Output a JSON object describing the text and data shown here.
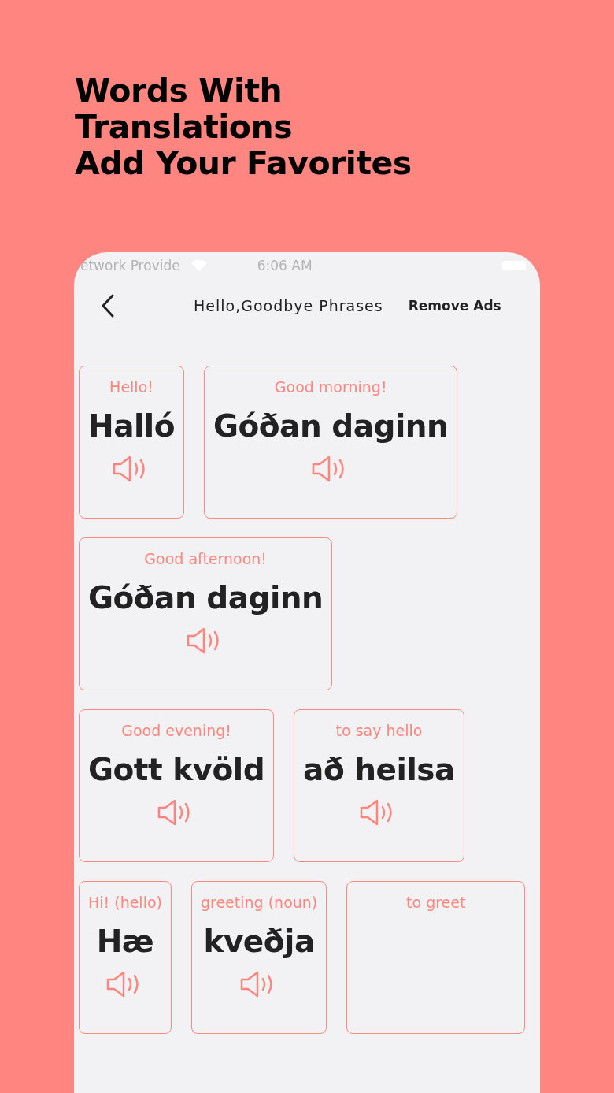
{
  "headline": [
    "Words With",
    "Translations",
    "Add Your Favorites"
  ],
  "status_bar": {
    "carrier": "etwork Provide",
    "time": "6:06 AM"
  },
  "header": {
    "title": "Hello,Goodbye Phrases",
    "action": "Remove Ads"
  },
  "cards": [
    {
      "translation": "Hello!",
      "word": "Halló"
    },
    {
      "translation": "Good morning!",
      "word": "Góðan daginn"
    },
    {
      "translation": "Good afternoon!",
      "word": "Góðan daginn"
    },
    {
      "translation": "Good evening!",
      "word": "Gott kvöld"
    },
    {
      "translation": "to say hello",
      "word": "að heilsa"
    },
    {
      "translation": "Hi! (hello)",
      "word": "Hæ"
    },
    {
      "translation": "greeting (noun)",
      "word": "kveðja"
    },
    {
      "translation": "to greet"
    }
  ]
}
